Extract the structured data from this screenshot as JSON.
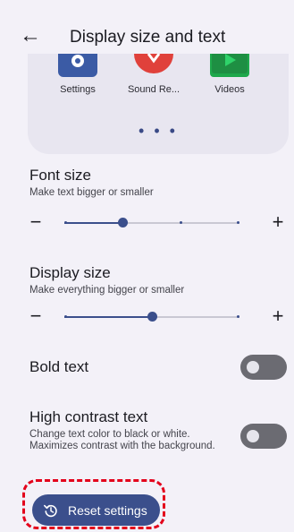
{
  "header": {
    "back_icon": "arrow-left-icon",
    "back_glyph": "←",
    "title": "Display size and text"
  },
  "preview": {
    "apps": [
      {
        "label": "Settings",
        "icon": "settings-gear-app-icon",
        "color": "#3b5ba5"
      },
      {
        "label": "Sound Re...",
        "icon": "sound-recorder-app-icon",
        "color": "#e0413b"
      },
      {
        "label": "Videos",
        "icon": "videos-play-app-icon",
        "color": "#1ea84b"
      }
    ],
    "page_dots": "• • •"
  },
  "font_size": {
    "title": "Font size",
    "subtitle": "Make text bigger or smaller",
    "minus": "−",
    "plus": "+",
    "level": 0.33,
    "steps": 4
  },
  "display_size": {
    "title": "Display size",
    "subtitle": "Make everything bigger or smaller",
    "minus": "−",
    "plus": "+",
    "level": 0.5,
    "steps": 3
  },
  "bold_text": {
    "title": "Bold text",
    "enabled": false
  },
  "high_contrast": {
    "title": "High contrast text",
    "subtitle": "Change text color to black or white. Maximizes contrast with the background.",
    "enabled": false
  },
  "reset": {
    "label": "Reset settings",
    "icon": "history-reset-icon"
  },
  "colors": {
    "accent": "#3b4f8c",
    "background": "#f3f1f8",
    "highlight": "#e3001b"
  }
}
